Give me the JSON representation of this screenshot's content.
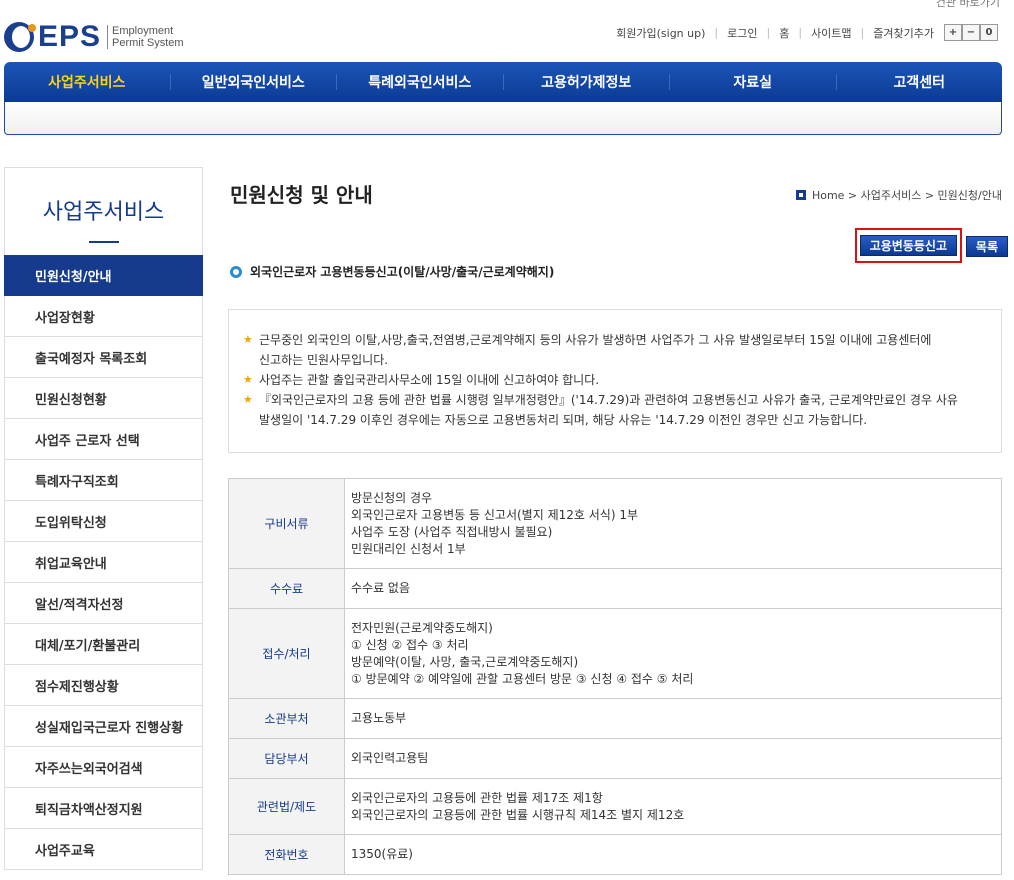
{
  "header": {
    "top_cut": "건관 바로가기",
    "logo": {
      "eps": "EPS",
      "sub1": "Employment",
      "sub2": "Permit System"
    },
    "util_links": [
      "회원가입(sign up)",
      "로그인",
      "홈",
      "사이트맵",
      "즐겨찾기추가"
    ],
    "font_buttons": [
      "+",
      "−",
      "0"
    ]
  },
  "nav": {
    "items": [
      "사업주서비스",
      "일반외국인서비스",
      "특례외국인서비스",
      "고용허가제정보",
      "자료실",
      "고객센터"
    ],
    "active_index": 0
  },
  "sidebar": {
    "title": "사업주서비스",
    "items": [
      "민원신청/안내",
      "사업장현황",
      "출국예정자 목록조회",
      "민원신청현황",
      "사업주 근로자 선택",
      "특례자구직조회",
      "도입위탁신청",
      "취업교육안내",
      "알선/적격자선정",
      "대체/포기/환불관리",
      "점수제진행상황",
      "성실재입국근로자 진행상황",
      "자주쓰는외국어검색",
      "퇴직금차액산정지원",
      "사업주교육"
    ],
    "active_index": 0
  },
  "main": {
    "title": "민원신청 및 안내",
    "breadcrumb": "Home > 사업주서비스 > 민원신청/안내",
    "apply_button": "고용변동등신고",
    "list_button": "목록",
    "section_title": "외국인근로자 고용변동등신고(이탈/사망/출국/근로계약해지)",
    "notices": [
      {
        "line1": "근무중인 외국인의 이탈,사망,출국,전염병,근로계약해지 등의 사유가 발생하면 사업주가 그 사유 발생일로부터 15일 이내에 고용센터에",
        "line2": "신고하는 민원사무입니다."
      },
      {
        "line1": "사업주는 관할 출입국관리사무소에 15일 이내에 신고하여야 합니다.",
        "line2": ""
      },
      {
        "line1": "『외국인근로자의 고용 등에 관한 법률 시행령 일부개정령안』('14.7.29)과 관련하여 고용변동신고 사유가 출국, 근로계약만료인 경우 사유",
        "line2": "발생일이 '14.7.29 이후인 경우에는 자동으로 고용변동처리 되며, 해당 사유는 '14.7.29 이전인 경우만 신고 가능합니다."
      }
    ],
    "table": [
      {
        "label": "구비서류",
        "lines": [
          "방문신청의 경우",
          "외국인근로자 고용변동 등 신고서(별지 제12호 서식) 1부",
          "사업주 도장 (사업주 직접내방시 불필요)",
          "민원대리인 신청서 1부"
        ]
      },
      {
        "label": "수수료",
        "lines": [
          "수수료 없음"
        ]
      },
      {
        "label": "접수/처리",
        "lines": [
          "전자민원(근로계약중도해지)",
          "① 신청 ② 접수 ③ 처리",
          "방문예약(이탈, 사망, 출국,근로계약중도해지)",
          "① 방문예약 ② 예약일에 관할 고용센터 방문 ③ 신청 ④ 접수 ⑤ 처리"
        ]
      },
      {
        "label": "소관부처",
        "lines": [
          "고용노동부"
        ]
      },
      {
        "label": "담당부서",
        "lines": [
          "외국인력고용팀"
        ]
      },
      {
        "label": "관련법/제도",
        "lines": [
          "외국인근로자의 고용등에 관한 법률 제17조 제1항",
          "외국인근로자의 고용등에 관한 법률 시행규칙 제14조 별지 제12호"
        ]
      },
      {
        "label": "전화번호",
        "lines": [
          "1350(유료)"
        ]
      }
    ]
  }
}
